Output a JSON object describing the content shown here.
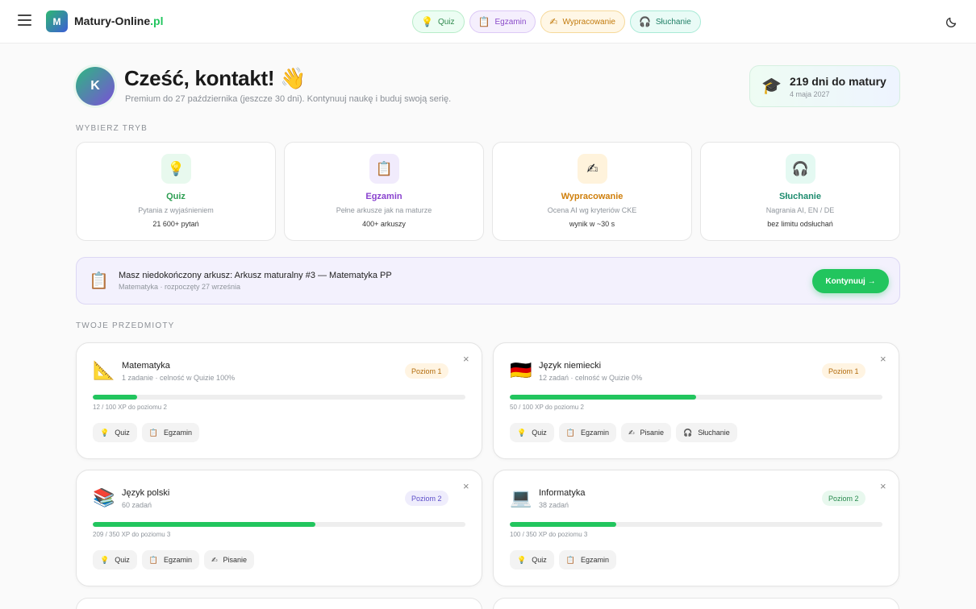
{
  "header": {
    "logo_letter": "M",
    "brand": "Matury-Online",
    "brand_tld": ".pl",
    "nav": [
      {
        "label": "Quiz",
        "icon": "💡"
      },
      {
        "label": "Egzamin",
        "icon": "📋"
      },
      {
        "label": "Wypracowanie",
        "icon": "✍"
      },
      {
        "label": "Słuchanie",
        "icon": "🎧"
      }
    ]
  },
  "hero": {
    "avatar_letter": "K",
    "greeting": "Cześć, kontakt! 👋",
    "subtitle": "Premium do 27 października (jeszcze 30 dni). Kontynuuj naukę i buduj swoją serię.",
    "countdown_icon": "🎓",
    "countdown_days": "219 dni do matury",
    "countdown_date": "4 maja 2027"
  },
  "modes_label": "Wybierz tryb",
  "modes": [
    {
      "title": "Quiz",
      "desc": "Pytania z wyjaśnieniem",
      "stat": "21 600+ pytań",
      "icon": "💡",
      "color": "#2e9f53",
      "bg": "#e8f9ee"
    },
    {
      "title": "Egzamin",
      "desc": "Pełne arkusze jak na maturze",
      "stat": "400+ arkuszy",
      "icon": "📋",
      "color": "#8a43cf",
      "bg": "#f1ebfc"
    },
    {
      "title": "Wypracowanie",
      "desc": "Ocena AI wg kryteriów CKE",
      "stat": "wynik w ~30 s",
      "icon": "✍",
      "color": "#cf7f0c",
      "bg": "#fff3dc"
    },
    {
      "title": "Słuchanie",
      "desc": "Nagrania AI, EN / DE",
      "stat": "bez limitu odsłuchań",
      "icon": "🎧",
      "color": "#1e8c6f",
      "bg": "#e4f9f2"
    }
  ],
  "banner": {
    "icon": "📋",
    "title": "Masz niedokończony arkusz: Arkusz maturalny #3 — Matematyka PP",
    "subtitle": "Matematyka · rozpoczęty 27 września",
    "button": "Kontynuuj →"
  },
  "subjects_label": "Twoje przedmioty",
  "subjects": [
    {
      "name": "Matematyka",
      "meta": "1 zadanie · celność w Quizie 100%",
      "icon": "📐",
      "level": "Poziom 1",
      "progress": 0.12,
      "xp": "12 / 100 XP do poziomu 2",
      "chips": [
        {
          "icon": "💡",
          "label": "Quiz"
        },
        {
          "icon": "📋",
          "label": "Egzamin"
        }
      ]
    },
    {
      "name": "Język niemiecki",
      "meta": "12 zadań · celność w Quizie 0%",
      "icon": "🇩🇪",
      "level": "Poziom 1",
      "progress": 0.5,
      "xp": "50 / 100 XP do poziomu 2",
      "chips": [
        {
          "icon": "💡",
          "label": "Quiz"
        },
        {
          "icon": "📋",
          "label": "Egzamin"
        },
        {
          "icon": "✍",
          "label": "Pisanie"
        },
        {
          "icon": "🎧",
          "label": "Słuchanie"
        }
      ]
    },
    {
      "name": "Język polski",
      "meta": "60 zadań",
      "icon": "📚",
      "level": "Poziom 2",
      "progress": 0.597,
      "xp": "209 / 350 XP do poziomu 3",
      "chips": [
        {
          "icon": "💡",
          "label": "Quiz"
        },
        {
          "icon": "📋",
          "label": "Egzamin"
        },
        {
          "icon": "✍",
          "label": "Pisanie"
        }
      ]
    },
    {
      "name": "Informatyka",
      "meta": "38 zadań",
      "icon": "💻",
      "level": "Poziom 2",
      "progress": 0.286,
      "xp": "100 / 350 XP do poziomu 3",
      "chips": [
        {
          "icon": "💡",
          "label": "Quiz"
        },
        {
          "icon": "📋",
          "label": "Egzamin"
        }
      ]
    }
  ],
  "close_glyph": "×"
}
